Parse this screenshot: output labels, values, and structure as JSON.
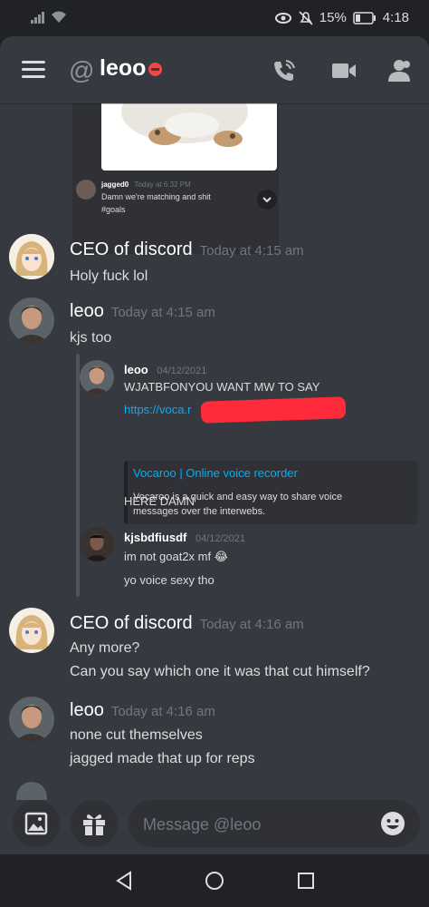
{
  "status": {
    "battery": "15%",
    "time": "4:18"
  },
  "header": {
    "at": "@",
    "title": "leoo"
  },
  "embed": {
    "author": "jagged0",
    "timestamp": "Today at 6:32 PM",
    "line1": "Damn we're matching and shit",
    "line2": "#goals"
  },
  "messages": [
    {
      "author": "CEO of discord",
      "timestamp": "Today at 4:15 am",
      "lines": [
        "Holy fuck lol"
      ]
    },
    {
      "author": "leoo",
      "timestamp": "Today at 4:15 am",
      "lines": [
        "kjs too"
      ]
    },
    {
      "author": "CEO of discord",
      "timestamp": "Today at 4:16 am",
      "lines": [
        "Any more?",
        "Can you say which one it was that cut himself?"
      ]
    },
    {
      "author": "leoo",
      "timestamp": "Today at 4:16 am",
      "lines": [
        "none cut themselves",
        "jagged made that up for reps"
      ]
    }
  ],
  "quote": {
    "author": "leoo",
    "date": "04/12/2021",
    "text": "WJATBFONYOU WANT MW TO SAY",
    "link": "https://voca.r",
    "card_title": "Vocaroo | Online voice recorder",
    "card_desc_1": "Vocaroo is a quick and easy way to share voice",
    "card_desc_2": "messages over the interwebs.",
    "after": "HERE DAMN",
    "reply_author": "kjsbdfiusdf",
    "reply_date": "04/12/2021",
    "reply_line1": "im not goat2x mf 😂",
    "reply_line2": "yo voice sexy tho"
  },
  "composer": {
    "placeholder": "Message @leoo"
  },
  "colors": {
    "background": "#36393f",
    "dark": "#202225",
    "link": "#00b0f4",
    "dnd": "#f04747",
    "redaction": "#ff2a3a"
  }
}
